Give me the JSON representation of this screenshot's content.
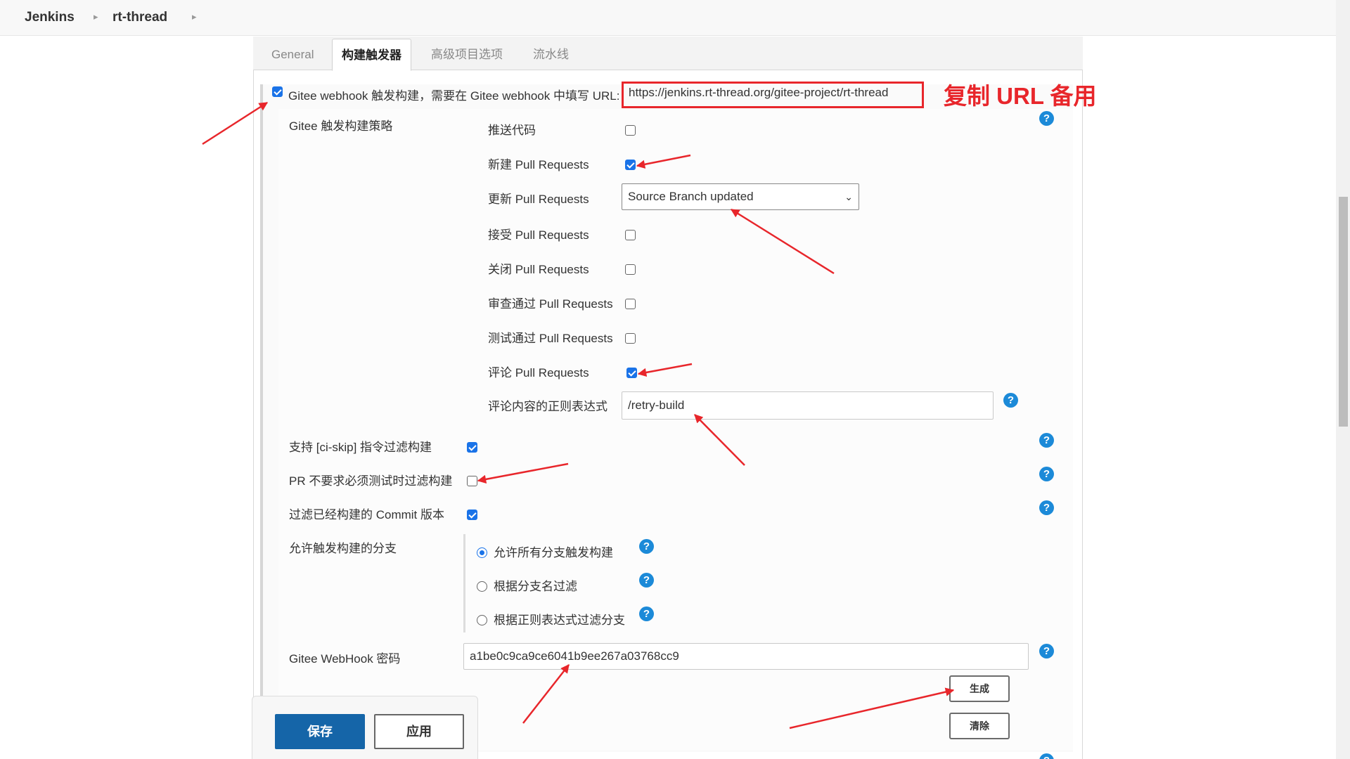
{
  "breadcrumb": {
    "home": "Jenkins",
    "project": "rt-thread"
  },
  "tabs": [
    {
      "label": "General",
      "active": false
    },
    {
      "label": "构建触发器",
      "active": true
    },
    {
      "label": "高级项目选项",
      "active": false
    },
    {
      "label": "流水线",
      "active": false
    }
  ],
  "webhook_trigger": {
    "label": "Gitee webhook 触发构建，需要在 Gitee webhook 中填写 URL:",
    "url": "https://jenkins.rt-thread.org/gitee-project/rt-thread",
    "checked": true
  },
  "annotation": {
    "copy_url_note": "复制 URL 备用",
    "color": "#e8262b"
  },
  "strategy": {
    "label": "Gitee 触发构建策略",
    "items": [
      {
        "label": "推送代码",
        "checked": false
      },
      {
        "label": "新建 Pull Requests",
        "checked": true
      },
      {
        "label": "接受 Pull Requests",
        "checked": false
      },
      {
        "label": "关闭 Pull Requests",
        "checked": false
      },
      {
        "label": "审查通过 Pull Requests",
        "checked": false
      },
      {
        "label": "测试通过 Pull Requests",
        "checked": false
      },
      {
        "label": "评论 Pull Requests",
        "checked": true
      }
    ],
    "update_pr": {
      "label": "更新 Pull Requests",
      "selected": "Source Branch updated"
    },
    "comment_regex": {
      "label": "评论内容的正则表达式",
      "value": "/retry-build"
    }
  },
  "options": [
    {
      "label": "支持 [ci-skip] 指令过滤构建",
      "checked": true
    },
    {
      "label": "PR 不要求必须测试时过滤构建",
      "checked": false
    },
    {
      "label": "过滤已经构建的 Commit 版本",
      "checked": true
    }
  ],
  "branches": {
    "label": "允许触发构建的分支",
    "choices": [
      {
        "label": "允许所有分支触发构建",
        "selected": true
      },
      {
        "label": "根据分支名过滤",
        "selected": false
      },
      {
        "label": "根据正则表达式过滤分支",
        "selected": false
      }
    ]
  },
  "secret": {
    "label": "Gitee WebHook 密码",
    "value": "a1be0c9ca9ce6041b9ee267a03768cc9",
    "generate_label": "生成",
    "clear_label": "清除"
  },
  "actions": {
    "save": "保存",
    "apply": "应用"
  },
  "colors": {
    "accent": "#1a73e8",
    "primary_button": "#1565a8",
    "help": "#1c8ad8"
  }
}
